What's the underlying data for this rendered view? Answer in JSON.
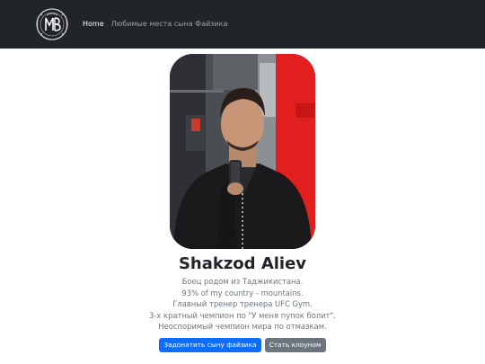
{
  "navbar": {
    "logo_icon": "monogram-crest-logo",
    "links": [
      {
        "label": "Home",
        "active": true
      },
      {
        "label": "Любимые места сына Файзика",
        "active": false
      }
    ]
  },
  "profile": {
    "photo_icon": "portrait-photo",
    "name": "Shakzod Aliev",
    "bio": [
      "Боец родом из Таджикистана.",
      "93% of my country - mountains.",
      "Главный тренер тренера UFC Gym.",
      "3-х кратный чемпион по \"У меня пупок болит\".",
      "Неоспоримый чемпион мира по отмазкам."
    ]
  },
  "actions": {
    "primary_label": "Задонатить сыну файзика",
    "secondary_label": "Стать клоуном"
  },
  "colors": {
    "navbar_bg": "#212529",
    "primary": "#0d6efd",
    "secondary": "#6c757d"
  }
}
